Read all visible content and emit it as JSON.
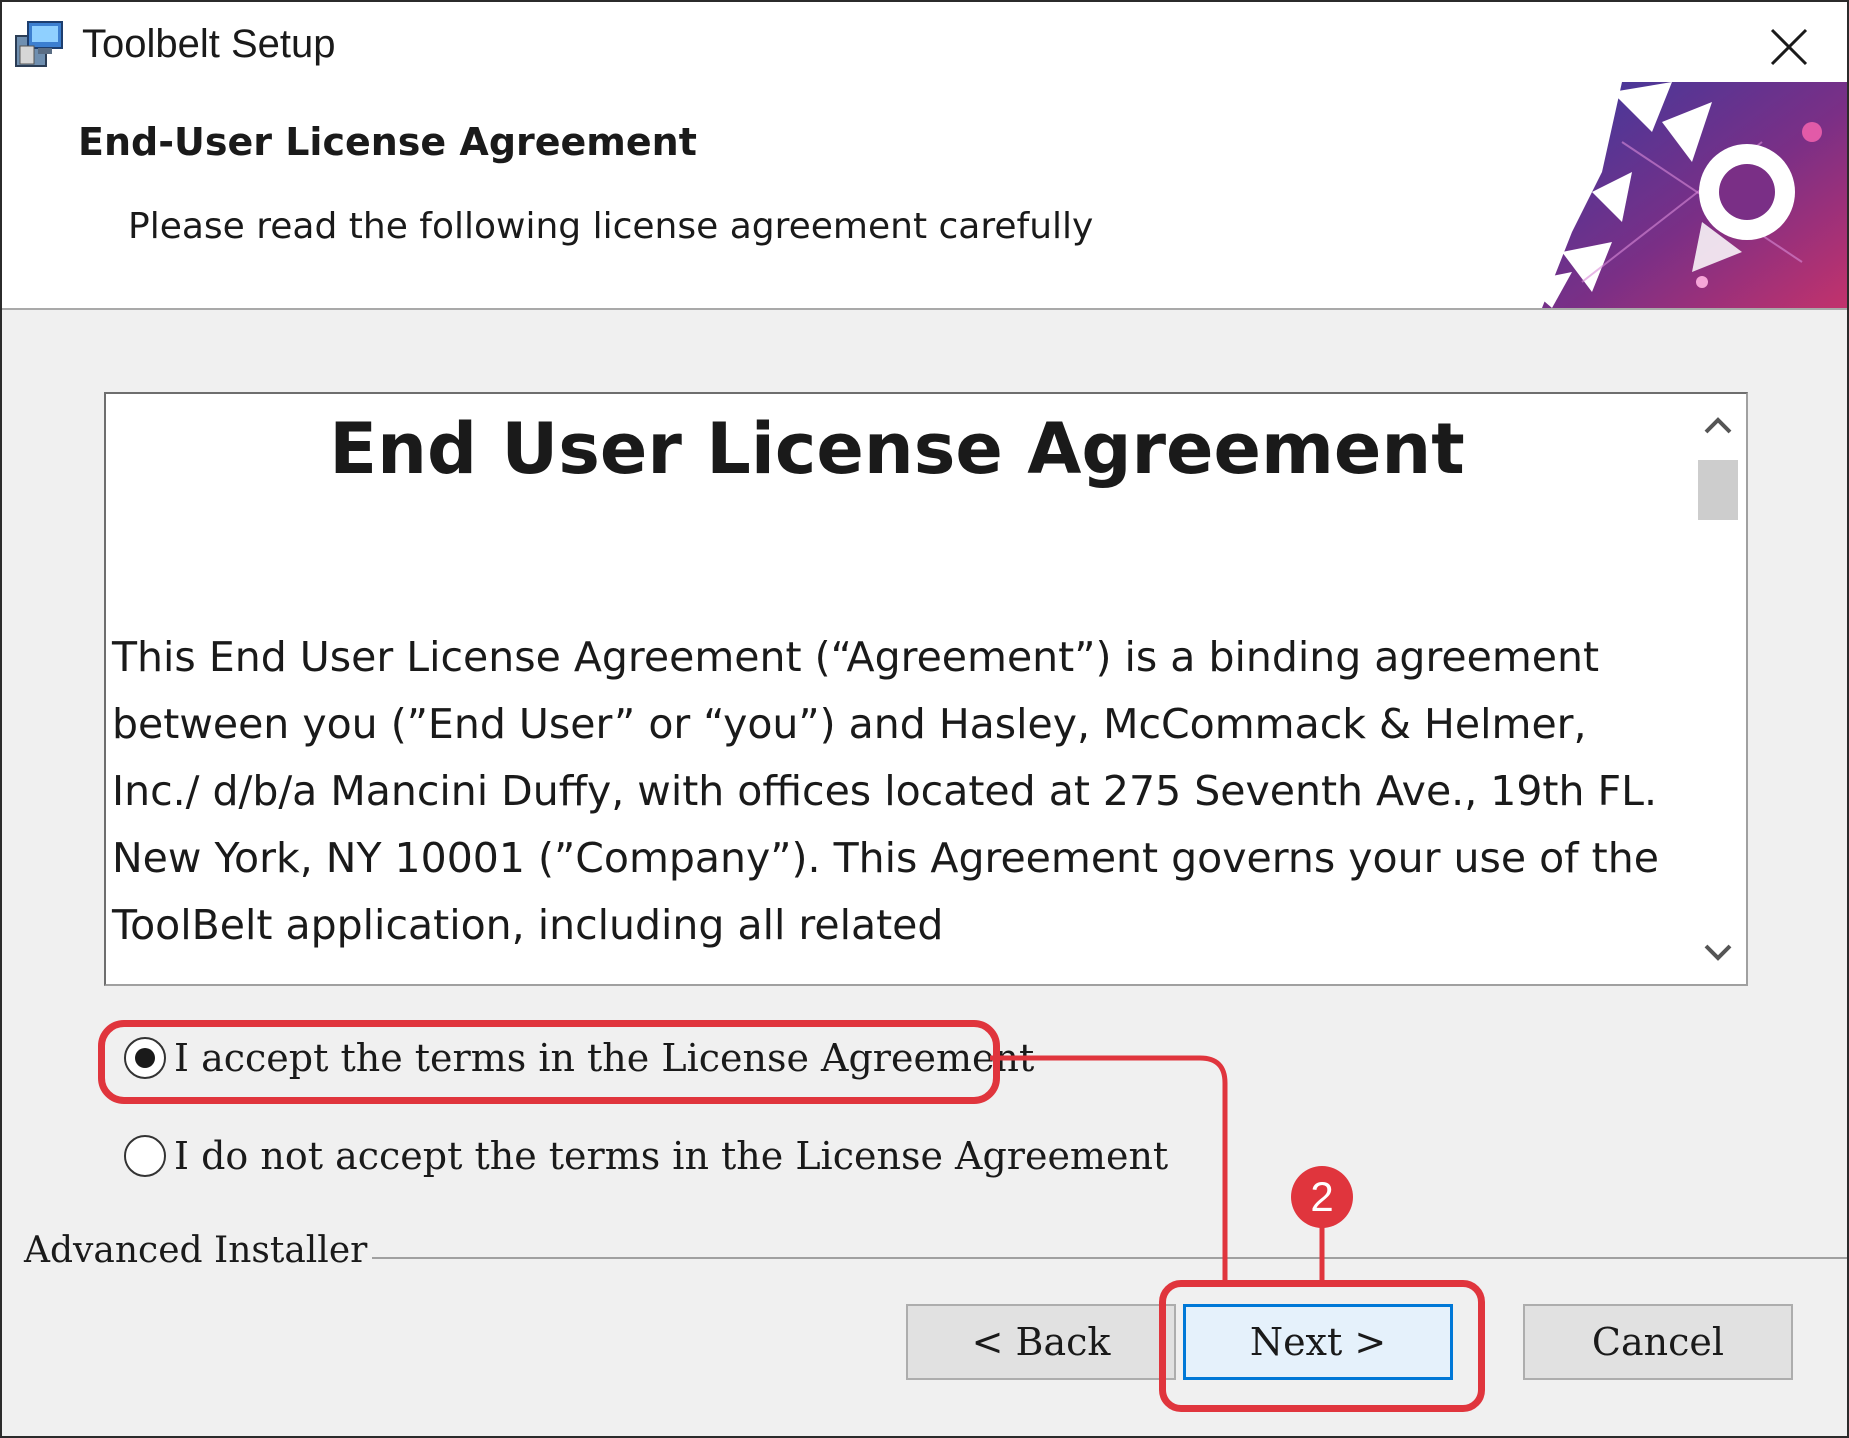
{
  "window": {
    "title": "Toolbelt Setup"
  },
  "header": {
    "title": "End-User License Agreement",
    "subtitle": "Please read the following license agreement carefully"
  },
  "license": {
    "heading": "End User License Agreement",
    "body": "This End User License Agreement (“Agreement”) is a binding agreement between you (”End User” or “you”) and Hasley, McCommack & Helmer, Inc./ d/b/a Mancini Duffy,  with offices located at 275 Seventh Ave., 19th FL. New York, NY 10001 (”Company”). This Agreement governs your use of the ToolBelt application, including all related"
  },
  "options": {
    "accept_label": "I accept the terms in the License Agreement",
    "decline_label": "I do not accept the terms in the License Agreement",
    "selected": "accept"
  },
  "footer": {
    "installer_label": "Advanced Installer",
    "back_label": "< Back",
    "next_label": "Next >",
    "cancel_label": "Cancel"
  },
  "annotation": {
    "step_number": "2",
    "color": "#e0353d"
  },
  "colors": {
    "focus_blue": "#0078d7",
    "dialog_bg": "#f0f0f0"
  }
}
